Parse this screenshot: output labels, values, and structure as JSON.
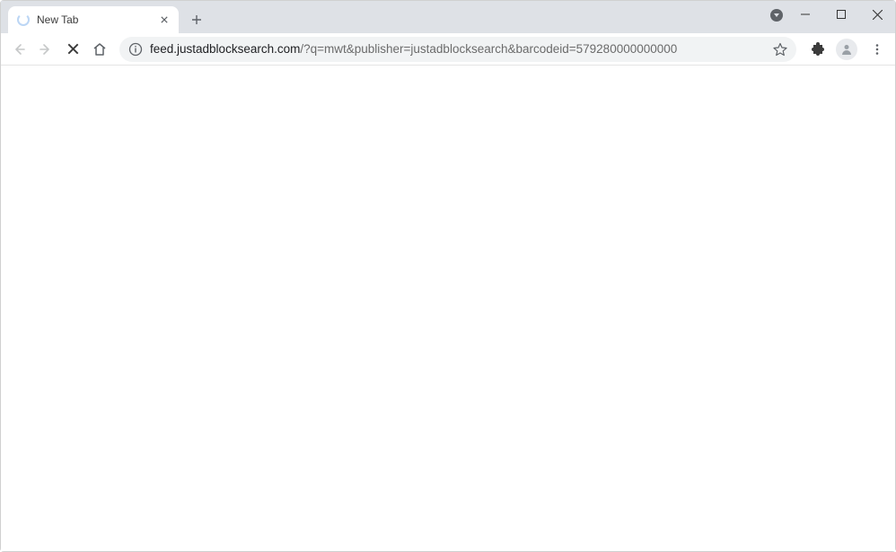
{
  "tab": {
    "title": "New Tab"
  },
  "addressbar": {
    "url_host": "feed.justadblocksearch.com",
    "url_path": "/?q=mwt&publisher=justadblocksearch&barcodeid=579280000000000"
  }
}
